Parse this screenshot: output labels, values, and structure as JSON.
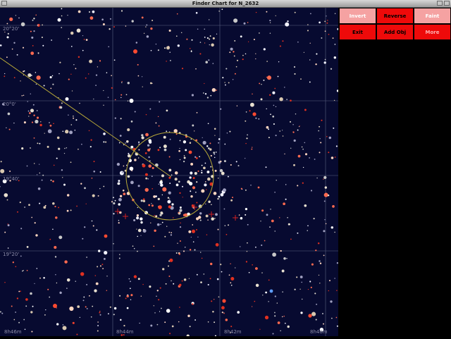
{
  "window": {
    "title": "Finder Chart for N_2632"
  },
  "chart": {
    "background": "#070a30",
    "grid_color": "#5a6080",
    "overlay_color": "#b8a838",
    "dec_labels": [
      "19°20'",
      "19°40'",
      "20°0'",
      "20°20'"
    ],
    "ra_labels": [
      "8h40m",
      "8h42m",
      "8h44m",
      "8h46m"
    ]
  },
  "buttons": [
    {
      "label": "Invert",
      "style": "pink"
    },
    {
      "label": "Reverse",
      "style": "red"
    },
    {
      "label": "Faint",
      "style": "pink"
    },
    {
      "label": "Exit",
      "style": "red"
    },
    {
      "label": "Add Obj",
      "style": "red"
    },
    {
      "label": "More",
      "style": "red-white"
    }
  ]
}
